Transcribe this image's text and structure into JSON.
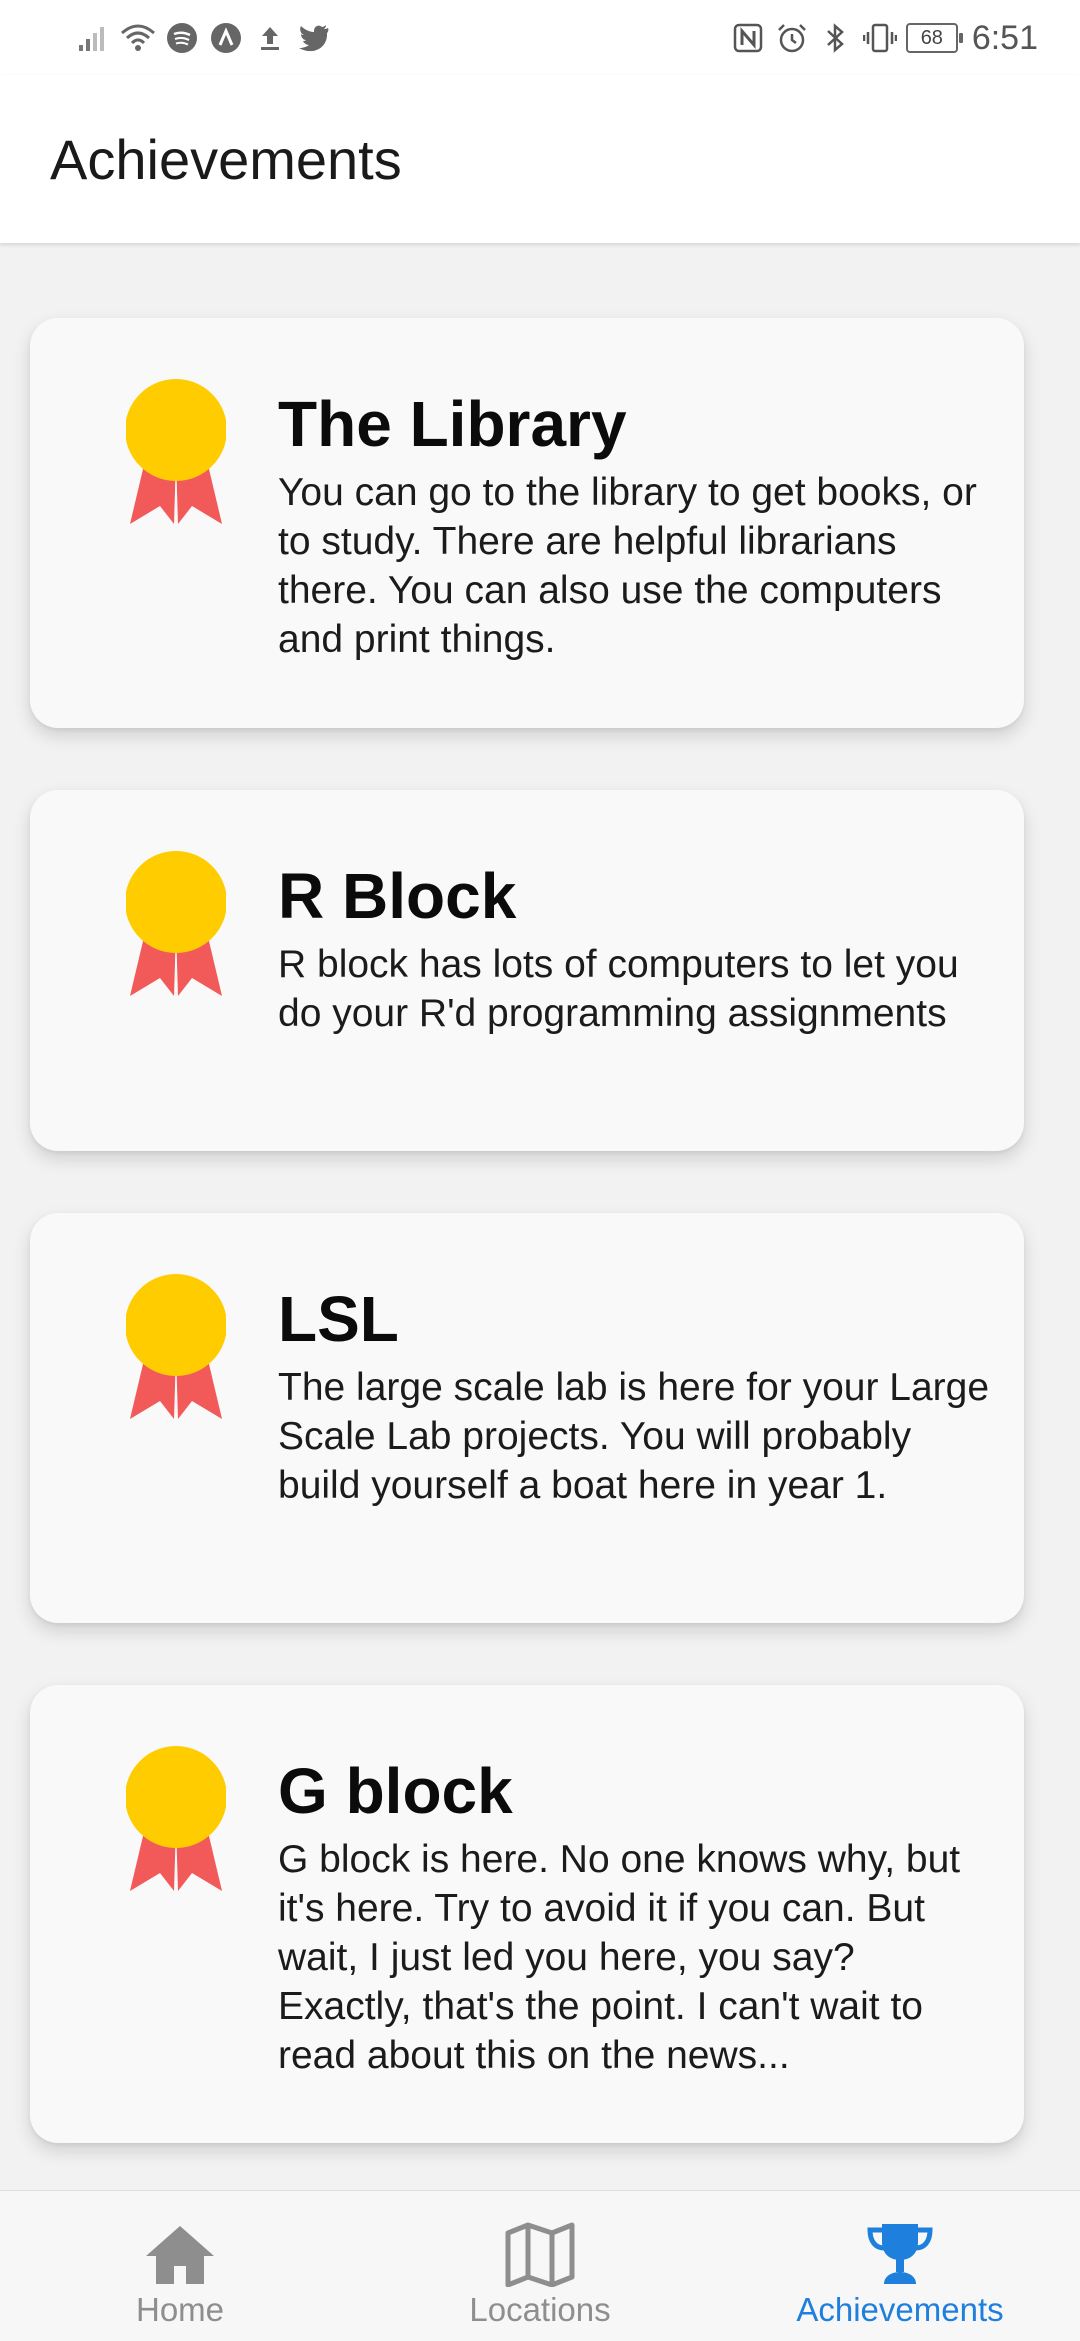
{
  "status_bar": {
    "time": "6:51",
    "battery": "68",
    "left_icons": [
      "signal-icon",
      "wifi-icon",
      "spotify-icon",
      "app-icon",
      "upload-icon",
      "twitter-icon"
    ],
    "right_icons": [
      "nfc-icon",
      "alarm-icon",
      "bluetooth-icon",
      "vibrate-icon"
    ]
  },
  "header": {
    "title": "Achievements"
  },
  "colors": {
    "medal_gold": "#FFCC00",
    "ribbon_red": "#F25A5A",
    "active_tab": "#1F7FDC",
    "inactive_tab": "#8E8E8E"
  },
  "achievements": [
    {
      "title": "The Library",
      "description": "You can go to the library to get books, or to study. There are helpful librarians there. You can also use the computers and print things.",
      "icon": "medal-icon"
    },
    {
      "title": "R Block",
      "description": "R block has lots of computers to let you do your R'd programming assignments",
      "icon": "medal-icon"
    },
    {
      "title": "LSL",
      "description": "The large scale lab is here for your Large Scale Lab projects. You will probably build yourself a boat here in year 1.",
      "icon": "medal-icon"
    },
    {
      "title": "G block",
      "description": "G block is here. No one knows why, but it's here. Try to avoid it if you can. But wait, I just led you here, you say? Exactly, that's the point. I can't wait to read about this on the news...",
      "icon": "medal-icon"
    }
  ],
  "bottom_nav": {
    "items": [
      {
        "label": "Home",
        "icon": "home-icon",
        "active": false
      },
      {
        "label": "Locations",
        "icon": "map-icon",
        "active": false
      },
      {
        "label": "Achievements",
        "icon": "trophy-icon",
        "active": true
      }
    ]
  }
}
